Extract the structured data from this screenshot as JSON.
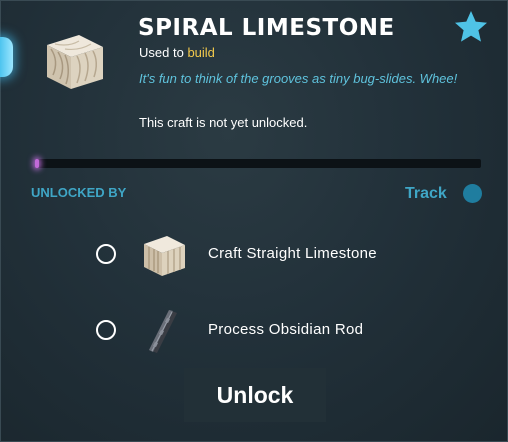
{
  "item": {
    "title": "SPIRAL LIMESTONE",
    "used_to_prefix": "Used to",
    "used_to_keyword": "build",
    "flavor_text": "It's fun to think of the grooves as tiny bug-slides. Whee!",
    "status": "This craft is not yet unlocked.",
    "icon": "limestone-block-icon",
    "favorite_icon": "star-icon"
  },
  "progress": {
    "value": 0.01
  },
  "unlock_section": {
    "heading": "UNLOCKED BY",
    "track_label": "Track",
    "requirements": [
      {
        "label": "Craft Straight Limestone",
        "icon": "straight-limestone-icon",
        "completed": false
      },
      {
        "label": "Process Obsidian Rod",
        "icon": "obsidian-rod-icon",
        "completed": false
      }
    ]
  },
  "actions": {
    "unlock_label": "Unlock"
  },
  "colors": {
    "accent": "#3fa6c6",
    "keyword": "#f2c94c",
    "flavor": "#5fc3dd",
    "star": "#4fc3e6",
    "progress": "#c26ad8"
  }
}
